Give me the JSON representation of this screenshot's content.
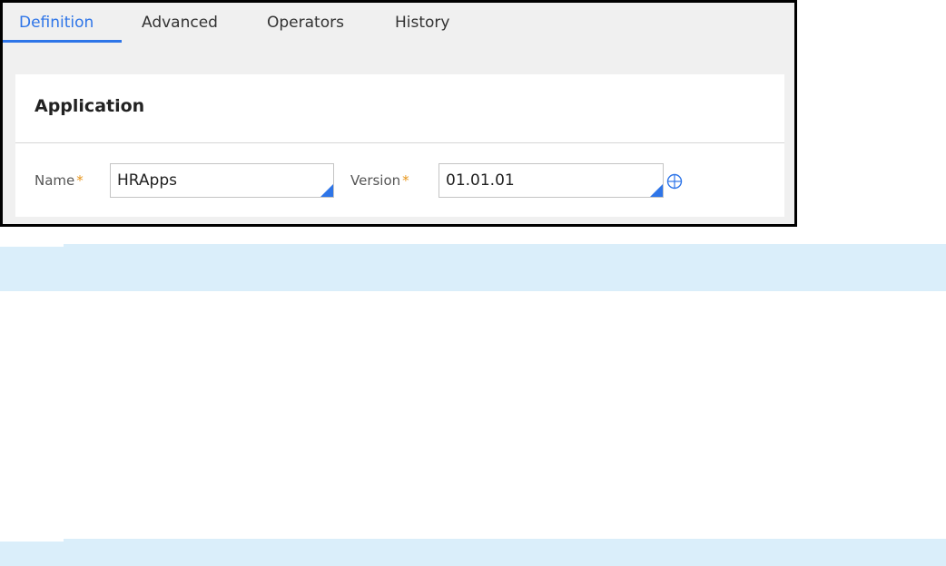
{
  "tabs": [
    {
      "label": "Definition",
      "active": true
    },
    {
      "label": "Advanced",
      "active": false
    },
    {
      "label": "Operators",
      "active": false
    },
    {
      "label": "History",
      "active": false
    }
  ],
  "application": {
    "title": "Application",
    "name": {
      "label": "Name",
      "required_marker": "*",
      "value": "HRApps"
    },
    "version": {
      "label": "Version",
      "required_marker": "*",
      "value": "01.01.01"
    },
    "lookup_icon": "crosshair-icon"
  },
  "colors": {
    "accent": "#2e75e8",
    "required": "#e8951a",
    "band": "#daeefa",
    "frame_border": "#000000"
  }
}
